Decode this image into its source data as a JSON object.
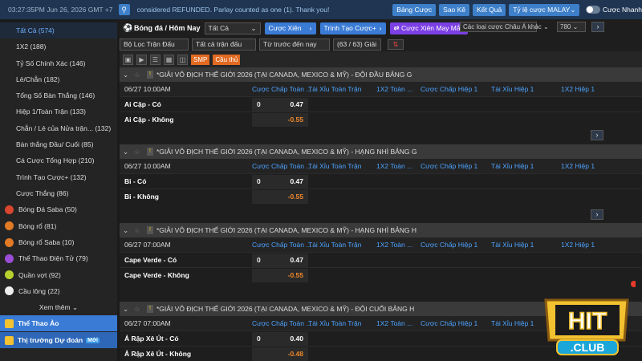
{
  "top": {
    "time": "03:27:35PM Jun 26, 2026 GMT +7",
    "ticker": "considered REFUNDED. Parlay counted as one (1). Thank you!",
    "buttons": [
      "Bảng Cược",
      "Sao Kê",
      "Kết Quả"
    ],
    "odds_type": "Tỷ lệ cược MALAY",
    "toggle_label": "Cược Nhanh"
  },
  "sidebar": {
    "subs": [
      {
        "label": "Tất Cả",
        "count": "(574)"
      },
      {
        "label": "1X2",
        "count": "(188)"
      },
      {
        "label": "Tỷ Số Chính Xác",
        "count": "(146)"
      },
      {
        "label": "Lẻ/Chẵn",
        "count": "(182)"
      },
      {
        "label": "Tổng Số Bàn Thắng",
        "count": "(146)"
      },
      {
        "label": "Hiệp 1/Toàn Trận",
        "count": "(133)"
      },
      {
        "label": "Chẵn / Lẻ của Nửa trận...",
        "count": "(132)"
      },
      {
        "label": "Bàn thắng Đầu/ Cuối",
        "count": "(85)"
      },
      {
        "label": "Cá Cược Tổng Hợp",
        "count": "(210)"
      },
      {
        "label": "Trình Tạo Cược+",
        "count": "(132)"
      },
      {
        "label": "Cược Thắng",
        "count": "(86)"
      }
    ],
    "sports": [
      {
        "label": "Bóng Đá Saba",
        "count": "(50)",
        "color": "#d9462f"
      },
      {
        "label": "Bóng rổ",
        "count": "(81)",
        "color": "#e27a25"
      },
      {
        "label": "Bóng rổ Saba",
        "count": "(10)",
        "color": "#e27a25"
      },
      {
        "label": "Thể Thao Điện Tử",
        "count": "(79)",
        "color": "#9b4dd6"
      },
      {
        "label": "Quần vợt",
        "count": "(92)",
        "color": "#b8d12f"
      },
      {
        "label": "Cầu lông",
        "count": "(22)",
        "color": "#eeeeee"
      }
    ],
    "more": "Xem thêm",
    "virtual": "Thể Thao Ảo",
    "market": "Thị trường Dự đoán",
    "new_badge": "Mới"
  },
  "main": {
    "crumb": "Bóng đá / Hôm Nay",
    "all_select": "Tất Cả",
    "xien": "Cược Xiên",
    "creator": "Trình Tạo Cược+",
    "lucky": "Cược Xiên May Mắn",
    "filters": [
      "Bộ Lọc Trận Đấu",
      "Tất cả trận đấu",
      "Từ trước đến nay",
      "(63 / 63) Giải"
    ],
    "smp": "SMP",
    "outright": "Cầu thủ",
    "bet_type": "Các loại cược Châu Á khác",
    "count_sel": "780",
    "columns": [
      "Cược Chấp Toàn ...",
      "Tài Xỉu Toàn Trận",
      "1X2 Toàn ...",
      "Cược Chấp Hiệp 1",
      "Tài Xỉu Hiệp 1",
      "1X2 Hiệp 1"
    ],
    "leagues": [
      {
        "name": "*GIẢI VÔ ĐỊCH THẾ GIỚI 2026 (TẠI CANADA, MEXICO & MỸ) - ĐỘI ĐẦU BẢNG G",
        "time": "06/27 10:00AM",
        "rows": [
          {
            "team": "Ai Cập - Có",
            "h": "0",
            "odds": "0.47",
            "neg": false
          },
          {
            "team": "Ai Cập - Không",
            "h": "",
            "odds": "-0.55",
            "neg": true
          }
        ]
      },
      {
        "name": "*GIẢI VÔ ĐỊCH THẾ GIỚI 2026 (TẠI CANADA, MEXICO & MỸ) - HẠNG NHÌ BẢNG G",
        "time": "06/27 10:00AM",
        "rows": [
          {
            "team": "Bỉ - Có",
            "h": "0",
            "odds": "0.47",
            "neg": false
          },
          {
            "team": "Bỉ - Không",
            "h": "",
            "odds": "-0.55",
            "neg": true
          }
        ]
      },
      {
        "name": "*GIẢI VÔ ĐỊCH THẾ GIỚI 2026 (TẠI CANADA, MEXICO & MỸ) - HẠNG NHÌ BẢNG H",
        "time": "06/27 07:00AM",
        "rows": [
          {
            "team": "Cape Verde - Có",
            "h": "0",
            "odds": "0.47",
            "neg": false
          },
          {
            "team": "Cape Verde - Không",
            "h": "",
            "odds": "-0.55",
            "neg": true
          }
        ]
      },
      {
        "name": "*GIẢI VÔ ĐỊCH THẾ GIỚI 2026 (TẠI CANADA, MEXICO & MỸ) - ĐỘI CUỐI BẢNG H",
        "time": "06/27 07:00AM",
        "rows": [
          {
            "team": "Ả Rập Xê Út - Có",
            "h": "0",
            "odds": "0.40",
            "neg": false
          },
          {
            "team": "Ả Rập Xê Út - Không",
            "h": "",
            "odds": "-0.48",
            "neg": true
          }
        ]
      }
    ]
  },
  "logo": {
    "text1": "HIT",
    "text2": ".CLUB"
  }
}
